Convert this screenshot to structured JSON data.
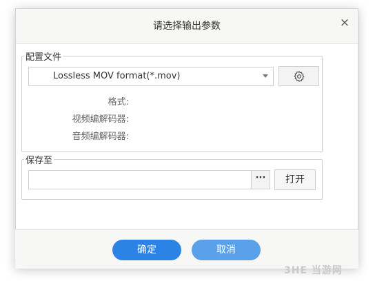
{
  "dialog": {
    "title": "请选择输出参数",
    "close_label": "×"
  },
  "profile": {
    "legend": "配置文件",
    "selected": "Lossless MOV format(*.mov)",
    "format_label": "格式:",
    "video_codec_label": "视频编解码器:",
    "audio_codec_label": "音频编解码器:"
  },
  "save": {
    "legend": "保存至",
    "path_value": "",
    "browse_label": "···",
    "open_label": "打开"
  },
  "footer": {
    "ok_label": "确定",
    "cancel_label": "取消"
  },
  "watermark": "3HE 当游网",
  "colors": {
    "ok_button": "#2b83e6",
    "cancel_button": "#5aa1ea"
  }
}
